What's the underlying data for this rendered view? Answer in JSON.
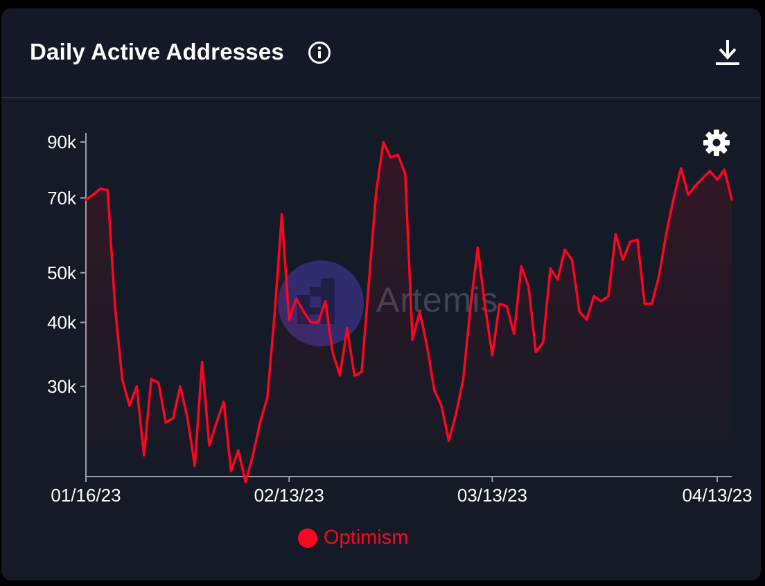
{
  "header": {
    "title": "Daily Active Addresses",
    "info_icon": "info-circle-icon",
    "download_icon": "download-icon"
  },
  "settings_icon": "gear-icon",
  "watermark": {
    "text": "Artemis"
  },
  "colors": {
    "series": "#ff0420",
    "background": "#141a26",
    "axis": "#9aa0aa"
  },
  "chart_data": {
    "type": "line",
    "title": "Daily Active Addresses",
    "xlabel": "",
    "ylabel": "",
    "y_scale": "log",
    "ylim": [
      20000,
      92000
    ],
    "y_ticks": [
      {
        "value": 30000,
        "label": "30k"
      },
      {
        "value": 40000,
        "label": "40k"
      },
      {
        "value": 50000,
        "label": "50k"
      },
      {
        "value": 70000,
        "label": "70k"
      },
      {
        "value": 90000,
        "label": "90k"
      }
    ],
    "x_ticks": [
      {
        "index": 0,
        "label": "01/16/23"
      },
      {
        "index": 28,
        "label": "02/13/23"
      },
      {
        "index": 56,
        "label": "03/13/23"
      },
      {
        "index": 87,
        "label": "04/13/23"
      }
    ],
    "x_start": "01/16/23",
    "x_end": "04/18/23",
    "grid": false,
    "legend_position": "bottom-center",
    "series": [
      {
        "name": "Optimism",
        "color": "#ff0420",
        "values": [
          69500,
          71000,
          73000,
          72500,
          43000,
          31000,
          27500,
          30000,
          22000,
          31000,
          30500,
          25500,
          26000,
          30000,
          26000,
          21000,
          33500,
          23000,
          25500,
          28000,
          20500,
          22500,
          19500,
          22000,
          25500,
          28500,
          41500,
          65000,
          40500,
          44500,
          42000,
          40000,
          40000,
          44000,
          35000,
          31500,
          39000,
          31500,
          32000,
          48000,
          72000,
          90000,
          84000,
          85000,
          78000,
          37000,
          42000,
          36000,
          29500,
          27500,
          23500,
          26500,
          31000,
          43000,
          56000,
          43000,
          34500,
          43500,
          43000,
          38000,
          51500,
          47000,
          35000,
          36500,
          51000,
          48500,
          55500,
          53000,
          42000,
          40500,
          45000,
          44000,
          45000,
          59500,
          53000,
          57500,
          58000,
          43500,
          43500,
          49500,
          60000,
          70000,
          80000,
          71000,
          74000,
          76500,
          79000,
          76000,
          79500,
          69500
        ]
      }
    ]
  },
  "legend": {
    "label": "Optimism"
  }
}
